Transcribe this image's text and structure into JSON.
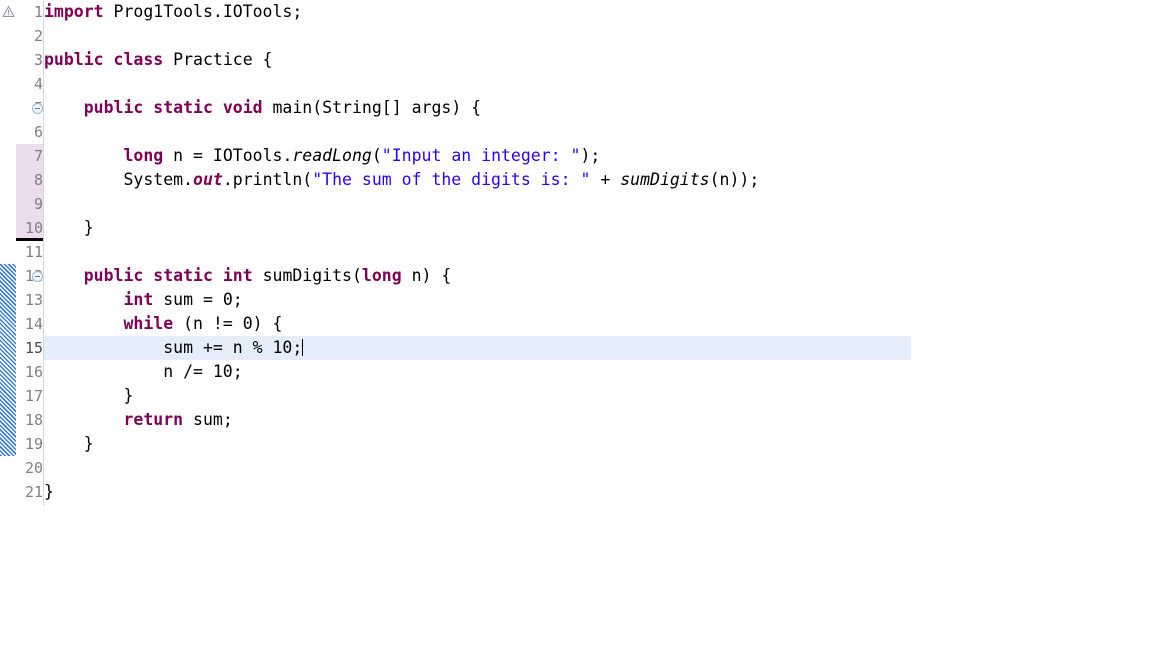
{
  "editor": {
    "language": "java",
    "font_size_px": 16.5,
    "line_height_px": 24,
    "colors": {
      "background": "#ffffff",
      "keyword": "#7f0055",
      "string": "#2a00ff",
      "plain": "#000000",
      "line_number": "#808080",
      "current_line_highlight": "#e4eefb",
      "gutter_changed_highlight": "#ecdcee",
      "gutter_added_bar": "#3a7fd5",
      "gutter_deleted_bar": "#000000",
      "gutter_border": "#d4d4e8"
    }
  },
  "markers": {
    "warning_icon": "warning-triangle-icon",
    "warning_line": 1,
    "fold_collapse_icon": "fold-collapse-icon",
    "fold_lines": [
      5,
      12
    ],
    "changed_lines": [
      7,
      8,
      9,
      10
    ],
    "deleted_marker_after_line": 10,
    "added_lines_start": 12,
    "added_lines_end": 19,
    "current_line": 15
  },
  "caret": {
    "line": 15,
    "after_text": "sum += n % 10;"
  },
  "lines": [
    {
      "number": 1,
      "tokens": [
        {
          "t": "import",
          "c": "kw"
        },
        {
          "t": " Prog1Tools.IOTools;",
          "c": "pln"
        }
      ]
    },
    {
      "number": 2,
      "tokens": []
    },
    {
      "number": 3,
      "tokens": [
        {
          "t": "public class",
          "c": "kw"
        },
        {
          "t": " Practice {",
          "c": "pln"
        }
      ]
    },
    {
      "number": 4,
      "tokens": []
    },
    {
      "number": 5,
      "tokens": [
        {
          "t": "    ",
          "c": "pln"
        },
        {
          "t": "public static void",
          "c": "kw"
        },
        {
          "t": " main(",
          "c": "pln"
        },
        {
          "t": "String",
          "c": "pln"
        },
        {
          "t": "[] args) {",
          "c": "pln"
        }
      ]
    },
    {
      "number": 6,
      "tokens": []
    },
    {
      "number": 7,
      "tokens": [
        {
          "t": "        ",
          "c": "pln"
        },
        {
          "t": "long",
          "c": "kw"
        },
        {
          "t": " n = IOTools.",
          "c": "pln"
        },
        {
          "t": "readLong",
          "c": "ital"
        },
        {
          "t": "(",
          "c": "pln"
        },
        {
          "t": "\"Input an integer: \"",
          "c": "str"
        },
        {
          "t": ");",
          "c": "pln"
        }
      ]
    },
    {
      "number": 8,
      "tokens": [
        {
          "t": "        System.",
          "c": "pln"
        },
        {
          "t": "out",
          "c": "kw-ital"
        },
        {
          "t": ".println(",
          "c": "pln"
        },
        {
          "t": "\"The sum of the digits is: \"",
          "c": "str"
        },
        {
          "t": " + ",
          "c": "pln"
        },
        {
          "t": "sumDigits",
          "c": "ital"
        },
        {
          "t": "(n));",
          "c": "pln"
        }
      ]
    },
    {
      "number": 9,
      "tokens": []
    },
    {
      "number": 10,
      "tokens": [
        {
          "t": "    }",
          "c": "pln"
        }
      ]
    },
    {
      "number": 11,
      "tokens": []
    },
    {
      "number": 12,
      "tokens": [
        {
          "t": "    ",
          "c": "pln"
        },
        {
          "t": "public static int",
          "c": "kw"
        },
        {
          "t": " sumDigits(",
          "c": "pln"
        },
        {
          "t": "long",
          "c": "kw"
        },
        {
          "t": " n) {",
          "c": "pln"
        }
      ]
    },
    {
      "number": 13,
      "tokens": [
        {
          "t": "        ",
          "c": "pln"
        },
        {
          "t": "int",
          "c": "kw"
        },
        {
          "t": " sum = 0;",
          "c": "pln"
        }
      ]
    },
    {
      "number": 14,
      "tokens": [
        {
          "t": "        ",
          "c": "pln"
        },
        {
          "t": "while",
          "c": "kw"
        },
        {
          "t": " (n != 0) {",
          "c": "pln"
        }
      ]
    },
    {
      "number": 15,
      "tokens": [
        {
          "t": "            sum += n % 10;",
          "c": "pln"
        }
      ]
    },
    {
      "number": 16,
      "tokens": [
        {
          "t": "            n /= 10;",
          "c": "pln"
        }
      ]
    },
    {
      "number": 17,
      "tokens": [
        {
          "t": "        }",
          "c": "pln"
        }
      ]
    },
    {
      "number": 18,
      "tokens": [
        {
          "t": "        ",
          "c": "pln"
        },
        {
          "t": "return",
          "c": "kw"
        },
        {
          "t": " sum;",
          "c": "pln"
        }
      ]
    },
    {
      "number": 19,
      "tokens": [
        {
          "t": "    }",
          "c": "pln"
        }
      ]
    },
    {
      "number": 20,
      "tokens": []
    },
    {
      "number": 21,
      "tokens": [
        {
          "t": "}",
          "c": "pln"
        }
      ]
    }
  ]
}
